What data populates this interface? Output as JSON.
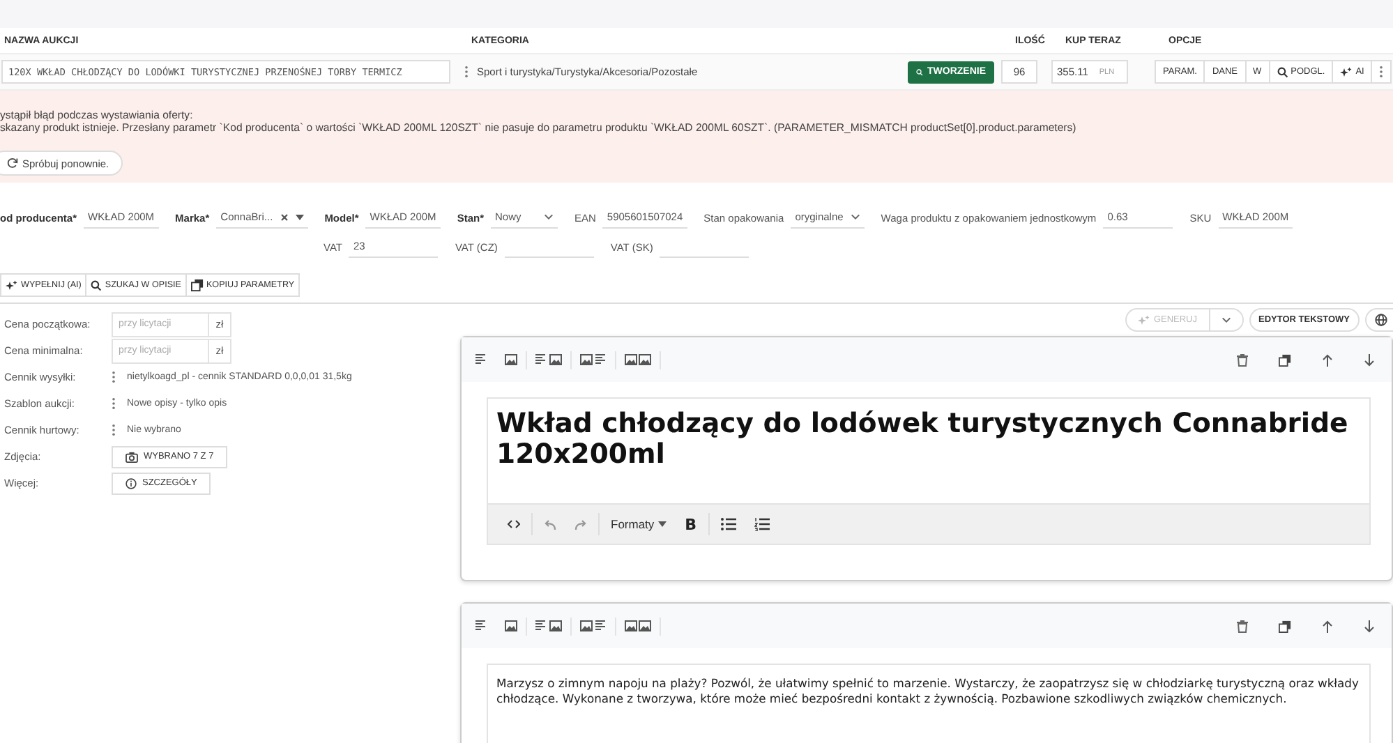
{
  "column_headers": [
    "NAZWA AUKCJI",
    "KATEGORIA",
    "ILOŚĆ",
    "KUP TERAZ",
    "OPCJE"
  ],
  "listing": {
    "title": "120X WKŁAD CHŁODZĄCY DO LODÓWKI TURYSTYCZNEJ PRZENOŚNEJ TORBY TERMICZ",
    "category": "Sport i turystyka/Turystyka/Akcesoria/Pozostałe",
    "status_button": "TWORZENIE",
    "quantity": "96",
    "price": "355.11",
    "currency": "PLN",
    "options": [
      {
        "label": "PARAM.",
        "kind": "plain"
      },
      {
        "label": "DANE",
        "kind": "plain"
      },
      {
        "label": "W",
        "kind": "plain"
      },
      {
        "label": "PODGL.",
        "kind": "preview"
      },
      {
        "label": "AI",
        "kind": "ai"
      },
      {
        "kind": "more"
      }
    ]
  },
  "error": {
    "lines": [
      "ystąpił błąd podczas wystawiania oferty:",
      "skazany produkt istnieje. Przesłany parametr `Kod producenta` o wartości `WKŁAD 200ML 120SZT` nie pasuje do parametru produktu `WKŁAD 200ML 60SZT`. (PARAMETER_MISMATCH productSet[0].product.parameters)"
    ],
    "retry": "Spróbuj ponownie."
  },
  "parameters": [
    {
      "label": "od producenta*",
      "required": true,
      "value": "WKŁAD 200M",
      "kind": "text"
    },
    {
      "label": "Marka*",
      "required": true,
      "value": "ConnaBri...",
      "kind": "tag"
    },
    {
      "label": "Model*",
      "required": true,
      "value": "WKŁAD 200M",
      "kind": "text"
    },
    {
      "label": "Stan*",
      "required": true,
      "value": "Nowy",
      "kind": "select"
    },
    {
      "label": "EAN",
      "required": false,
      "value": "5905601507024",
      "kind": "text"
    },
    {
      "label": "Stan opakowania",
      "required": false,
      "value": "oryginalne",
      "kind": "select"
    },
    {
      "label": "Waga produktu z opakowaniem jednostkowym",
      "required": false,
      "value": "0.63",
      "kind": "text"
    },
    {
      "label": "SKU",
      "required": false,
      "value": "WKŁAD 200M",
      "kind": "text"
    }
  ],
  "vat_parameters": [
    {
      "label": "VAT",
      "value": "23"
    },
    {
      "label": "VAT (CZ)"
    },
    {
      "label": "VAT (SK)"
    }
  ],
  "parameter_actions": [
    {
      "label": "WYPEŁNIJ (AI)",
      "kind": "ai"
    },
    {
      "label": "SZUKAJ W OPISIE",
      "kind": "search"
    },
    {
      "label": "KOPIUJ PARAMETRY",
      "kind": "copy"
    }
  ],
  "settings": [
    {
      "label": "Cena początkowa:",
      "kind": "price",
      "placeholder": "przy licytacji",
      "unit": "zł"
    },
    {
      "label": "Cena minimalna:",
      "kind": "price",
      "placeholder": "przy licytacji",
      "unit": "zł"
    },
    {
      "label": "Cennik wysyłki:",
      "kind": "select",
      "value": "nietylkoagd_pl - cennik STANDARD 0,0,0,01 31,5kg"
    },
    {
      "label": "Szablon aukcji:",
      "kind": "select",
      "value": "Nowe opisy - tylko opis"
    },
    {
      "label": "Cennik hurtowy:",
      "kind": "select",
      "value": "Nie wybrano"
    },
    {
      "label": "Zdjęcia:",
      "kind": "photos",
      "value": "WYBRANO 7 Z 7"
    },
    {
      "label": "Więcej:",
      "kind": "details",
      "value": "SZCZEGÓŁY"
    }
  ],
  "editor_actions": {
    "generate": "GENERUJ",
    "generate_disabled": true,
    "text_editor": "EDYTOR TEKSTOWY"
  },
  "sections": [
    {
      "kind": "heading",
      "text": "Wkład chłodzący do lodówek turystycznych Connabride 120x200ml",
      "formats": "Formaty",
      "bold_button": "B"
    },
    {
      "kind": "paragraph",
      "text": "Marzysz o zimnym napoju na plaży? Pozwól, że ułatwimy spełnić to marzenie. Wystarczy, że zaopatrzysz się w chłodziarkę turystyczną oraz wkłady chłodzące. Wykonane z tworzywa, które może mieć bezpośredni kontakt z żywnością. Pozbawione szkodliwych związków chemicznych."
    }
  ]
}
